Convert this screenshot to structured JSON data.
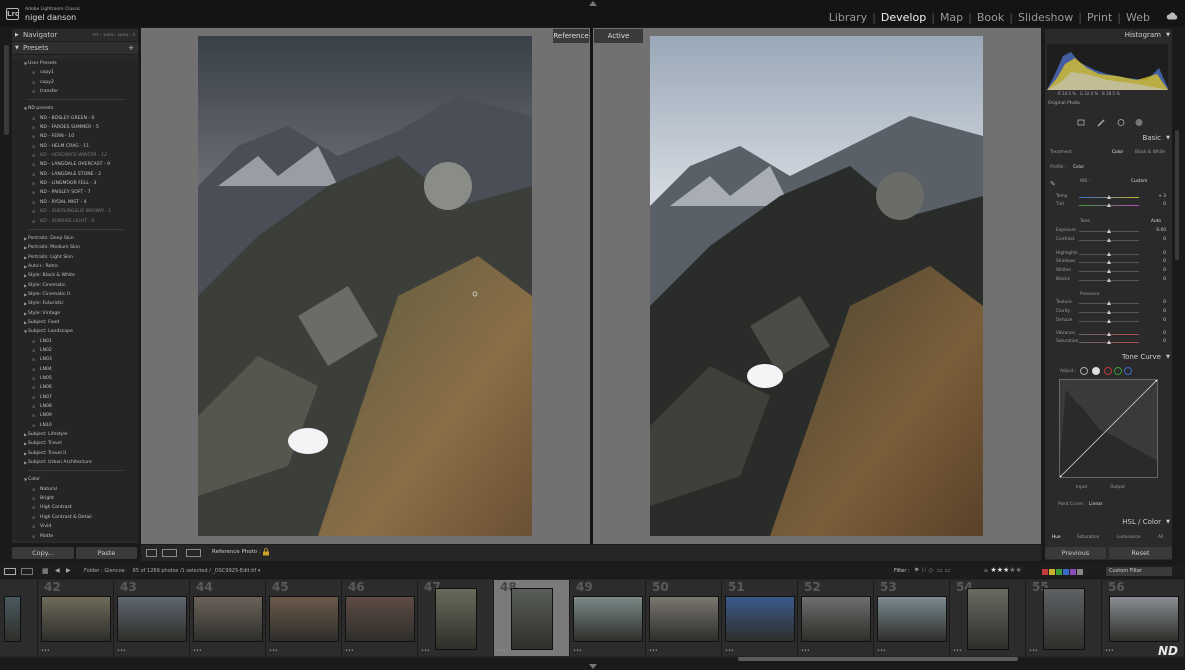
{
  "app": {
    "product": "Adobe Lightroom Classic",
    "user": "nigel danson",
    "logo_text": "Lrc"
  },
  "modules": [
    {
      "label": "Library",
      "active": false
    },
    {
      "label": "Develop",
      "active": true
    },
    {
      "label": "Map",
      "active": false
    },
    {
      "label": "Book",
      "active": false
    },
    {
      "label": "Slideshow",
      "active": false
    },
    {
      "label": "Print",
      "active": false
    },
    {
      "label": "Web",
      "active": false
    }
  ],
  "left_panel": {
    "navigator": {
      "title": "Navigator",
      "zoom_options": "FIT  :  100%  :  200%  :  3"
    },
    "presets_title": "Presets",
    "presets": [
      {
        "kind": "group",
        "label": "User Presets",
        "open": true
      },
      {
        "kind": "item",
        "label": "copy1"
      },
      {
        "kind": "item",
        "label": "copy2"
      },
      {
        "kind": "item",
        "label": "transfer"
      },
      {
        "kind": "rule"
      },
      {
        "kind": "group",
        "label": "ND presets",
        "open": true
      },
      {
        "kind": "item",
        "label": "ND - BOSLEY GREEN - 6"
      },
      {
        "kind": "item",
        "label": "ND - FAROES SUMMER - 5"
      },
      {
        "kind": "item",
        "label": "ND - FERN - 10"
      },
      {
        "kind": "item",
        "label": "ND - HELM CRAG - 11"
      },
      {
        "kind": "item",
        "label": "ND - HERDWICK WINTER - 12",
        "dim": true
      },
      {
        "kind": "item",
        "label": "ND - LANGDALE OVERCAST - 9"
      },
      {
        "kind": "item",
        "label": "ND - LANGDALE STONE - 2"
      },
      {
        "kind": "item",
        "label": "ND - LINGMOOR FELL - 3"
      },
      {
        "kind": "item",
        "label": "ND - PAISLEY SOFT - 7"
      },
      {
        "kind": "item",
        "label": "ND - RYDAL MIST - 4"
      },
      {
        "kind": "item",
        "label": "ND - SHEPLINGSLIE BROWN - 1",
        "dim": true
      },
      {
        "kind": "item",
        "label": "ND - SUNRISE LIGHT - 8",
        "dim": true
      },
      {
        "kind": "rule"
      },
      {
        "kind": "group",
        "label": "Portraits: Deep Skin"
      },
      {
        "kind": "group",
        "label": "Portraits: Medium Skin"
      },
      {
        "kind": "group",
        "label": "Portraits: Light Skin"
      },
      {
        "kind": "group",
        "label": "Auto+: Retro"
      },
      {
        "kind": "group",
        "label": "Style: Black & White"
      },
      {
        "kind": "group",
        "label": "Style: Cinematic"
      },
      {
        "kind": "group",
        "label": "Style: Cinematic II"
      },
      {
        "kind": "group",
        "label": "Style: Futuristic"
      },
      {
        "kind": "group",
        "label": "Style: Vintage"
      },
      {
        "kind": "group",
        "label": "Subject: Food"
      },
      {
        "kind": "group",
        "label": "Subject: Landscape",
        "open": true
      },
      {
        "kind": "item",
        "label": "LN01"
      },
      {
        "kind": "item",
        "label": "LN02"
      },
      {
        "kind": "item",
        "label": "LN03"
      },
      {
        "kind": "item",
        "label": "LN04"
      },
      {
        "kind": "item",
        "label": "LN05"
      },
      {
        "kind": "item",
        "label": "LN06"
      },
      {
        "kind": "item",
        "label": "LN07"
      },
      {
        "kind": "item",
        "label": "LN08"
      },
      {
        "kind": "item",
        "label": "LN09"
      },
      {
        "kind": "item",
        "label": "LN10"
      },
      {
        "kind": "group",
        "label": "Subject: Lifestyle"
      },
      {
        "kind": "group",
        "label": "Subject: Travel"
      },
      {
        "kind": "group",
        "label": "Subject: Travel II"
      },
      {
        "kind": "group",
        "label": "Subject: Urban Architecture"
      },
      {
        "kind": "rule"
      },
      {
        "kind": "group",
        "label": "Color",
        "open": true
      },
      {
        "kind": "item",
        "label": "Natural"
      },
      {
        "kind": "item",
        "label": "Bright"
      },
      {
        "kind": "item",
        "label": "High Contrast"
      },
      {
        "kind": "item",
        "label": "High Contrast & Detail"
      },
      {
        "kind": "item",
        "label": "Vivid"
      },
      {
        "kind": "item",
        "label": "Matte"
      }
    ],
    "copy_label": "Copy...",
    "paste_label": "Paste"
  },
  "center": {
    "reference_label": "Reference",
    "active_label": "Active",
    "toolbar_ref_photo": "Reference Photo :"
  },
  "right_panel": {
    "histogram": {
      "title": "Histogram",
      "r": "R  34.5 %",
      "g": "G  32.4 %",
      "b": "B  28.5 %",
      "original_photo": "Original Photo"
    },
    "basic": {
      "title": "Basic",
      "treatment_label": "Treatment :",
      "treatment_color": "Color",
      "treatment_bw": "Black & White",
      "profile_label": "Profile :",
      "profile_value": "Color",
      "wb_label": "WB :",
      "wb_value": "Custom",
      "tone_label": "Tone",
      "tone_auto": "Auto",
      "presence_label": "Presence",
      "sliders": [
        {
          "label": "Temp",
          "value": "+ 3",
          "pos": 0.5
        },
        {
          "label": "Tint",
          "value": "0",
          "pos": 0.5
        },
        {
          "label": "Exposure",
          "value": "0.00",
          "pos": 0.5
        },
        {
          "label": "Contrast",
          "value": "0",
          "pos": 0.5
        },
        {
          "label": "Highlights",
          "value": "0",
          "pos": 0.5
        },
        {
          "label": "Shadows",
          "value": "0",
          "pos": 0.5
        },
        {
          "label": "Whites",
          "value": "0",
          "pos": 0.5
        },
        {
          "label": "Blacks",
          "value": "0",
          "pos": 0.5
        },
        {
          "label": "Texture",
          "value": "0",
          "pos": 0.5
        },
        {
          "label": "Clarity",
          "value": "0",
          "pos": 0.5
        },
        {
          "label": "Dehaze",
          "value": "0",
          "pos": 0.5
        },
        {
          "label": "Vibrance",
          "value": "0",
          "pos": 0.5
        },
        {
          "label": "Saturation",
          "value": "0",
          "pos": 0.5
        }
      ]
    },
    "tone_curve": {
      "title": "Tone Curve",
      "adjust": "Adjust :",
      "input": "Input",
      "output": "Output",
      "point_curve_label": "Point Curve :",
      "point_curve_value": "Linear"
    },
    "hsl": {
      "title": "HSL / Color",
      "tabs": [
        "Hue",
        "Saturation",
        "Luminance",
        "All"
      ]
    },
    "previous_label": "Previous",
    "reset_label": "Reset"
  },
  "filmstrip_bar": {
    "source": "Folder : Glencoe",
    "count": "65 of 1269 photos /1 selected /",
    "filename": "_DSC9925-Edit.tif",
    "filter_label": "Filter :",
    "custom_filter": "Custom Filter",
    "rating_filter": "≥"
  },
  "filmstrip": [
    {
      "num": "",
      "dots": "",
      "tone": "#4a5a60"
    },
    {
      "num": "42",
      "dots": "•••",
      "tone": "#6e6a5a"
    },
    {
      "num": "43",
      "dots": "•••",
      "tone": "#5e6670"
    },
    {
      "num": "44",
      "dots": "•••",
      "tone": "#6a625a"
    },
    {
      "num": "45",
      "dots": "•••",
      "tone": "#6a5a4a"
    },
    {
      "num": "46",
      "dots": "•••",
      "tone": "#5e4a44"
    },
    {
      "num": "47",
      "dots": "•••",
      "tone": "#6a6a5a"
    },
    {
      "num": "48",
      "dots": "•••",
      "tone": "#5a5e58",
      "selected": true
    },
    {
      "num": "49",
      "dots": "•••",
      "tone": "#7a8a88"
    },
    {
      "num": "50",
      "dots": "•••",
      "tone": "#7a7670"
    },
    {
      "num": "51",
      "dots": "•••",
      "tone": "#3a5a8a"
    },
    {
      "num": "52",
      "dots": "•••",
      "tone": "#6e6e6e"
    },
    {
      "num": "53",
      "dots": "•••",
      "tone": "#7a8a90"
    },
    {
      "num": "54",
      "dots": "•••",
      "tone": "#6a6a62"
    },
    {
      "num": "55",
      "dots": "•••",
      "tone": "#5e6266"
    },
    {
      "num": "56",
      "dots": "•••",
      "tone": "#8a8e94"
    }
  ],
  "watermark": "ND",
  "colors": {
    "accent": "#f2f2f2",
    "panel": "#2a2a2a",
    "canvas": "#717171"
  }
}
